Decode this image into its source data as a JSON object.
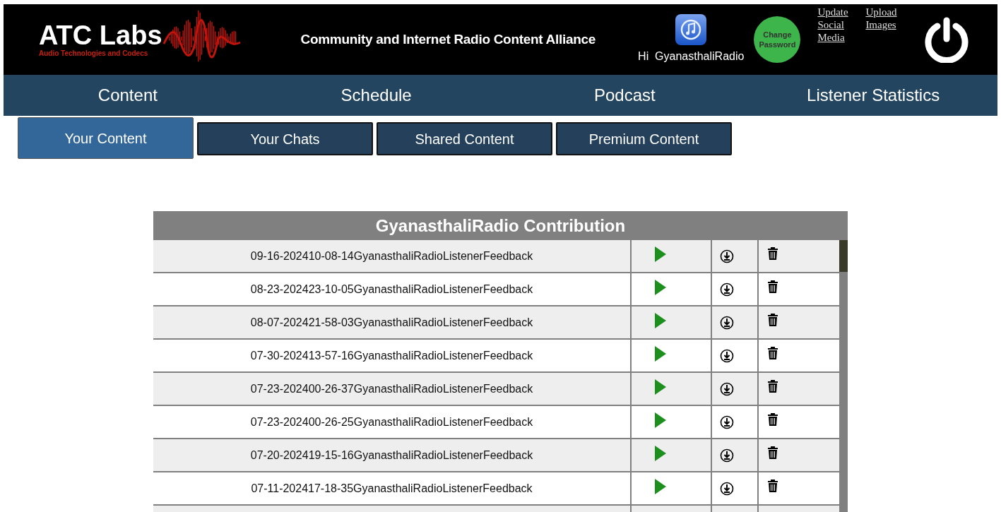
{
  "header": {
    "logo_title": "ATC Labs",
    "logo_subtitle": "Audio Technologies and Codecs",
    "tagline": "Community and Internet Radio Content Alliance",
    "greeting": "Hi  GyanasthaliRadio",
    "change_password": "Change Password",
    "links": [
      "Update Social Media",
      "Upload Images"
    ]
  },
  "nav": [
    "Content",
    "Schedule",
    "Podcast",
    "Listener Statistics"
  ],
  "tabs": [
    {
      "label": "Your Content",
      "selected": true
    },
    {
      "label": "Your Chats",
      "selected": false
    },
    {
      "label": "Shared Content",
      "selected": false
    },
    {
      "label": "Premium Content",
      "selected": false
    }
  ],
  "table": {
    "title": "GyanasthaliRadio Contribution",
    "rows": [
      "09-16-202410-08-14GyanasthaliRadioListenerFeedback",
      "08-23-202423-10-05GyanasthaliRadioListenerFeedback",
      "08-07-202421-58-03GyanasthaliRadioListenerFeedback",
      "07-30-202413-57-16GyanasthaliRadioListenerFeedback",
      "07-23-202400-26-37GyanasthaliRadioListenerFeedback",
      "07-23-202400-26-25GyanasthaliRadioListenerFeedback",
      "07-20-202419-15-16GyanasthaliRadioListenerFeedback",
      "07-11-202417-18-35GyanasthaliRadioListenerFeedback"
    ]
  }
}
